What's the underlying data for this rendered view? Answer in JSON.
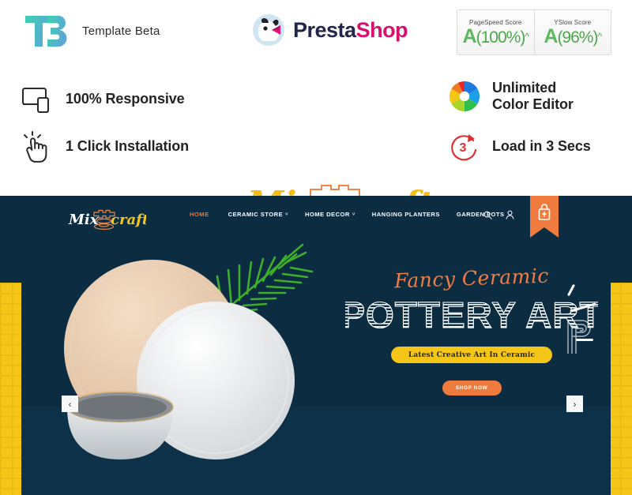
{
  "brandbar": {
    "template_vendor": "Template Beta",
    "prestashop_presta": "Presta",
    "prestashop_shop": "Shop",
    "scores": [
      {
        "label": "PageSpeed Score",
        "grade": "A",
        "percent": "(100%)",
        "caret": "^"
      },
      {
        "label": "YSlow Score",
        "grade": "A",
        "percent": "(96%)",
        "caret": "^"
      }
    ]
  },
  "features": [
    {
      "label": "100% Responsive",
      "icon": "responsive-devices-icon"
    },
    {
      "label": "1 Click Installation",
      "icon": "click-hand-icon"
    },
    {
      "label_line1": "Unlimited",
      "label_line2": "Color Editor",
      "icon": "color-wheel-icon"
    },
    {
      "label": "Load in 3 Secs",
      "icon": "stopwatch-3-icon",
      "value": "3"
    }
  ],
  "product_logo": {
    "word1": "Mix",
    "word2": "craft",
    "icon": "pottery-wheel-icon"
  },
  "site": {
    "logo": {
      "word1": "Mix",
      "word2": "craft"
    },
    "nav": [
      {
        "label": "HOME",
        "active": true,
        "caret": ""
      },
      {
        "label": "CERAMIC STORE",
        "active": false,
        "caret": "˅"
      },
      {
        "label": "HOME DECOR",
        "active": false,
        "caret": "˅"
      },
      {
        "label": "HANGING PLANTERS",
        "active": false,
        "caret": ""
      },
      {
        "label": "GARDEN POTS",
        "active": false,
        "caret": ""
      }
    ],
    "header_icons": [
      "search-icon",
      "user-account-icon",
      "shopping-bag-icon"
    ],
    "hero": {
      "script_heading": "Fancy Ceramic",
      "main_heading": "POTTERY ART",
      "tagline_pill": "Latest Creative Art In Ceramic",
      "cta_button": "SHOP NOW",
      "prev_arrow": "‹",
      "next_arrow": "›"
    }
  },
  "colors": {
    "navy": "#0b2c41",
    "navy_dark": "#0d3149",
    "orange": "#f07b3f",
    "orange_accent": "#ef7e44",
    "yellow": "#f5c518",
    "teal": "#45bfae",
    "presta_pink": "#d6106b",
    "presta_navy": "#23254b",
    "score_green": "#5cb85c",
    "red": "#e03131"
  }
}
